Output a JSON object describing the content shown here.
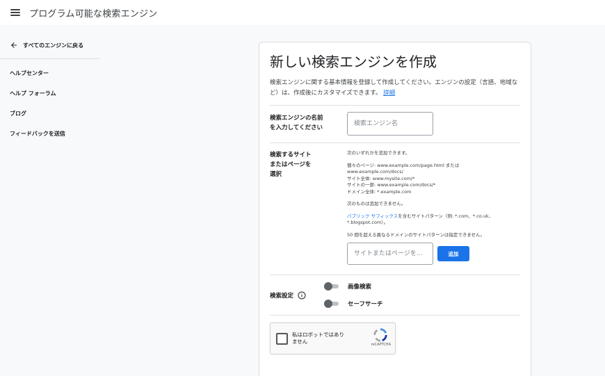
{
  "header": {
    "title": "プログラム可能な検索エンジン"
  },
  "sidebar": {
    "back_label": "すべてのエンジンに戻る",
    "items": [
      {
        "label": "ヘルプセンター"
      },
      {
        "label": "ヘルプ フォーラム"
      },
      {
        "label": "ブログ"
      },
      {
        "label": "フィードバックを送信"
      }
    ]
  },
  "main": {
    "title": "新しい検索エンジンを作成",
    "description": "検索エンジンに関する基本情報を登録して作成してください。エンジンの設定（言語、地域など）は、作成後にカスタマイズできます。",
    "description_link": "詳細",
    "name_section": {
      "label_line1": "検索エンジンの名前",
      "label_line2": "を入力してください",
      "placeholder": "検索エンジン名"
    },
    "site_section": {
      "label_line1": "検索するサイト",
      "label_line2": "またはページを",
      "label_line3": "選択",
      "can_add": "次のいずれかを追加できます。",
      "examples": [
        "個々のページ: www.example.com/page.html または",
        "www.example.com/docs/",
        "サイト全体: www.mysite.com/*",
        "サイトの一部: www.example.com/docs/*",
        "ドメイン全体: *.example.com"
      ],
      "cannot_add": "次のものは追加できません。",
      "suffix_link": "パブリック サフィックス",
      "suffix_text": "を含むサイトパターン（例: *.com、*.co.uk、",
      "suffix_text2": "*.blogspot.com）。",
      "limit_note": "50 個を超える異なるドメインのサイトパターンは指定できません。",
      "placeholder": "サイトまたはページを...",
      "add_button": "追加"
    },
    "settings": {
      "label": "検索設定",
      "toggles": [
        {
          "label": "画像検索",
          "on": false
        },
        {
          "label": "セーフサーチ",
          "on": false
        }
      ]
    },
    "captcha": {
      "line1": "私はロボットではあり",
      "line2": "ません",
      "brand": "reCAPTCHA"
    }
  },
  "colors": {
    "accent": "#1a73e8",
    "background": "#f8f9fa",
    "card": "#ffffff"
  }
}
